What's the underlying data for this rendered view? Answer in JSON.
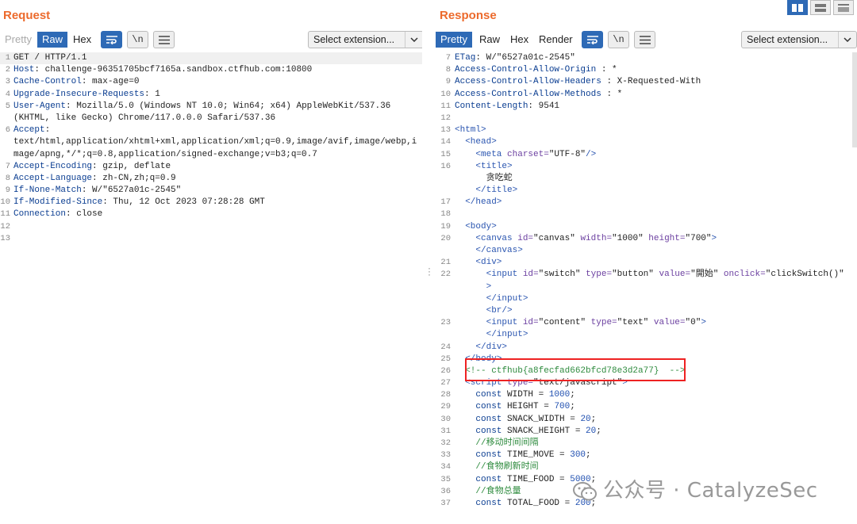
{
  "request": {
    "title": "Request",
    "tabs": [
      "Pretty",
      "Raw",
      "Hex"
    ],
    "icon_btns": [
      "⇶",
      "\\n",
      "≡"
    ],
    "select_label": "Select extension...",
    "lines": [
      {
        "n": "1",
        "segs": [
          [
            "GET / HTTP/1.1",
            ""
          ]
        ]
      },
      {
        "n": "2",
        "segs": [
          [
            "Host",
            "k"
          ],
          [
            ": challenge-96351705bcf7165a.sandbox.ctfhub.com:10800",
            ""
          ]
        ]
      },
      {
        "n": "3",
        "segs": [
          [
            "Cache-Control",
            "k"
          ],
          [
            ": max-age=0",
            ""
          ]
        ]
      },
      {
        "n": "4",
        "segs": [
          [
            "Upgrade-Insecure-Requests",
            "k"
          ],
          [
            ": 1",
            ""
          ]
        ]
      },
      {
        "n": "5",
        "segs": [
          [
            "User-Agent",
            "k"
          ],
          [
            ": Mozilla/5.0 (Windows NT 10.0; Win64; x64) AppleWebKit/537.36",
            ""
          ]
        ]
      },
      {
        "n": "",
        "segs": [
          [
            "(KHTML, like Gecko) Chrome/117.0.0.0 Safari/537.36",
            ""
          ]
        ]
      },
      {
        "n": "6",
        "segs": [
          [
            "Accept",
            "k"
          ],
          [
            ":",
            ""
          ]
        ]
      },
      {
        "n": "",
        "segs": [
          [
            "text/html,application/xhtml+xml,application/xml;q=0.9,image/avif,image/webp,i",
            ""
          ]
        ]
      },
      {
        "n": "",
        "segs": [
          [
            "mage/apng,*/*;q=0.8,application/signed-exchange;v=b3;q=0.7",
            ""
          ]
        ]
      },
      {
        "n": "7",
        "segs": [
          [
            "Accept-Encoding",
            "k"
          ],
          [
            ": gzip, deflate",
            ""
          ]
        ]
      },
      {
        "n": "8",
        "segs": [
          [
            "Accept-Language",
            "k"
          ],
          [
            ": zh-CN,zh;q=0.9",
            ""
          ]
        ]
      },
      {
        "n": "9",
        "segs": [
          [
            "If-None-Match",
            "k"
          ],
          [
            ": W/\"6527a01c-2545\"",
            ""
          ]
        ]
      },
      {
        "n": "10",
        "segs": [
          [
            "If-Modified-Since",
            "k"
          ],
          [
            ": Thu, 12 Oct 2023 07:28:28 GMT",
            ""
          ]
        ]
      },
      {
        "n": "11",
        "segs": [
          [
            "Connection",
            "k"
          ],
          [
            ": close",
            ""
          ]
        ]
      },
      {
        "n": "12",
        "segs": []
      },
      {
        "n": "13",
        "segs": []
      }
    ]
  },
  "response": {
    "title": "Response",
    "tabs": [
      "Pretty",
      "Raw",
      "Hex",
      "Render"
    ],
    "icon_btns": [
      "⇶",
      "\\n",
      "≡"
    ],
    "select_label": "Select extension...",
    "lines": [
      {
        "n": "7",
        "segs": [
          [
            "ETag",
            "k"
          ],
          [
            ": W/\"6527a01c-2545\"",
            ""
          ]
        ]
      },
      {
        "n": "8",
        "segs": [
          [
            "Access-Control-Allow-Origin",
            "k"
          ],
          [
            " : *",
            ""
          ]
        ]
      },
      {
        "n": "9",
        "segs": [
          [
            "Access-Control-Allow-Headers",
            "k"
          ],
          [
            " : X-Requested-With",
            ""
          ]
        ]
      },
      {
        "n": "10",
        "segs": [
          [
            "Access-Control-Allow-Methods",
            "k"
          ],
          [
            " : *",
            ""
          ]
        ]
      },
      {
        "n": "11",
        "segs": [
          [
            "Content-Length",
            "k"
          ],
          [
            ": 9541",
            ""
          ]
        ]
      },
      {
        "n": "12",
        "segs": []
      },
      {
        "n": "13",
        "segs": [
          [
            "<html>",
            "tag"
          ]
        ]
      },
      {
        "n": "14",
        "segs": [
          [
            "  <head>",
            "tag"
          ]
        ]
      },
      {
        "n": "15",
        "segs": [
          [
            "    <meta ",
            "tag"
          ],
          [
            "charset=",
            "attr"
          ],
          [
            "\"UTF-8\"",
            "val"
          ],
          [
            "/>",
            "tag"
          ]
        ]
      },
      {
        "n": "16",
        "segs": [
          [
            "    <title>",
            "tag"
          ]
        ]
      },
      {
        "n": "",
        "segs": [
          [
            "      贪吃蛇",
            ""
          ]
        ]
      },
      {
        "n": "",
        "segs": [
          [
            "    </title>",
            "tag"
          ]
        ]
      },
      {
        "n": "17",
        "segs": [
          [
            "  </head>",
            "tag"
          ]
        ]
      },
      {
        "n": "18",
        "segs": []
      },
      {
        "n": "19",
        "segs": [
          [
            "  <body>",
            "tag"
          ]
        ]
      },
      {
        "n": "20",
        "segs": [
          [
            "    <canvas ",
            "tag"
          ],
          [
            "id=",
            "attr"
          ],
          [
            "\"canvas\" ",
            "val"
          ],
          [
            "width=",
            "attr"
          ],
          [
            "\"1000\" ",
            "val"
          ],
          [
            "height=",
            "attr"
          ],
          [
            "\"700\"",
            "val"
          ],
          [
            ">",
            "tag"
          ]
        ]
      },
      {
        "n": "",
        "segs": [
          [
            "    </canvas>",
            "tag"
          ]
        ]
      },
      {
        "n": "21",
        "segs": [
          [
            "    <div>",
            "tag"
          ]
        ]
      },
      {
        "n": "22",
        "segs": [
          [
            "      <input ",
            "tag"
          ],
          [
            "id=",
            "attr"
          ],
          [
            "\"switch\" ",
            "val"
          ],
          [
            "type=",
            "attr"
          ],
          [
            "\"button\" ",
            "val"
          ],
          [
            "value=",
            "attr"
          ],
          [
            "\"開始\" ",
            "val"
          ],
          [
            "onclick=",
            "attr"
          ],
          [
            "\"clickSwitch()\"",
            "val"
          ]
        ]
      },
      {
        "n": "",
        "segs": [
          [
            "      >",
            "tag"
          ]
        ]
      },
      {
        "n": "",
        "segs": [
          [
            "      </input>",
            "tag"
          ]
        ]
      },
      {
        "n": "",
        "segs": [
          [
            "      <br/>",
            "tag"
          ]
        ]
      },
      {
        "n": "23",
        "segs": [
          [
            "      <input ",
            "tag"
          ],
          [
            "id=",
            "attr"
          ],
          [
            "\"content\" ",
            "val"
          ],
          [
            "type=",
            "attr"
          ],
          [
            "\"text\" ",
            "val"
          ],
          [
            "value=",
            "attr"
          ],
          [
            "\"0\"",
            "val"
          ],
          [
            ">",
            "tag"
          ]
        ]
      },
      {
        "n": "",
        "segs": [
          [
            "      </input>",
            "tag"
          ]
        ]
      },
      {
        "n": "24",
        "segs": [
          [
            "    </div>",
            "tag"
          ]
        ]
      },
      {
        "n": "25",
        "segs": [
          [
            "  </body>",
            "tag"
          ]
        ]
      },
      {
        "n": "26",
        "segs": [
          [
            "  <!-- ctfhub{a8fecfad662bfcd78e3d2a77}  -->",
            "cm"
          ]
        ]
      },
      {
        "n": "27",
        "segs": [
          [
            "  <script ",
            "tag"
          ],
          [
            "type=",
            "attr"
          ],
          [
            "\"text/javascript\"",
            "val"
          ],
          [
            ">",
            "tag"
          ]
        ]
      },
      {
        "n": "28",
        "segs": [
          [
            "    const ",
            "k"
          ],
          [
            "WIDTH = ",
            ""
          ],
          [
            "1000",
            "num"
          ],
          [
            ";",
            ""
          ]
        ]
      },
      {
        "n": "29",
        "segs": [
          [
            "    const ",
            "k"
          ],
          [
            "HEIGHT = ",
            ""
          ],
          [
            "700",
            "num"
          ],
          [
            ";",
            ""
          ]
        ]
      },
      {
        "n": "30",
        "segs": [
          [
            "    const ",
            "k"
          ],
          [
            "SNACK_WIDTH = ",
            ""
          ],
          [
            "20",
            "num"
          ],
          [
            ";",
            ""
          ]
        ]
      },
      {
        "n": "31",
        "segs": [
          [
            "    const ",
            "k"
          ],
          [
            "SNACK_HEIGHT = ",
            ""
          ],
          [
            "20",
            "num"
          ],
          [
            ";",
            ""
          ]
        ]
      },
      {
        "n": "32",
        "segs": [
          [
            "    //移动时间间隔",
            "cm"
          ]
        ]
      },
      {
        "n": "33",
        "segs": [
          [
            "    const ",
            "k"
          ],
          [
            "TIME_MOVE = ",
            ""
          ],
          [
            "300",
            "num"
          ],
          [
            ";",
            ""
          ]
        ]
      },
      {
        "n": "34",
        "segs": [
          [
            "    //食物刷新时间",
            "cm"
          ]
        ]
      },
      {
        "n": "35",
        "segs": [
          [
            "    const ",
            "k"
          ],
          [
            "TIME_FOOD = ",
            ""
          ],
          [
            "5000",
            "num"
          ],
          [
            ";",
            ""
          ]
        ]
      },
      {
        "n": "36",
        "segs": [
          [
            "    //食物总量",
            "cm"
          ]
        ]
      },
      {
        "n": "37",
        "segs": [
          [
            "    const ",
            "k"
          ],
          [
            "TOTAL_FOOD = ",
            ""
          ],
          [
            "200",
            "num"
          ],
          [
            ";",
            ""
          ]
        ]
      }
    ]
  },
  "watermark": "公众号 · CatalyzeSec",
  "colors": {
    "accent": "#2e6ab6",
    "title": "#ec6a2c",
    "flag_box": "#e22222"
  }
}
